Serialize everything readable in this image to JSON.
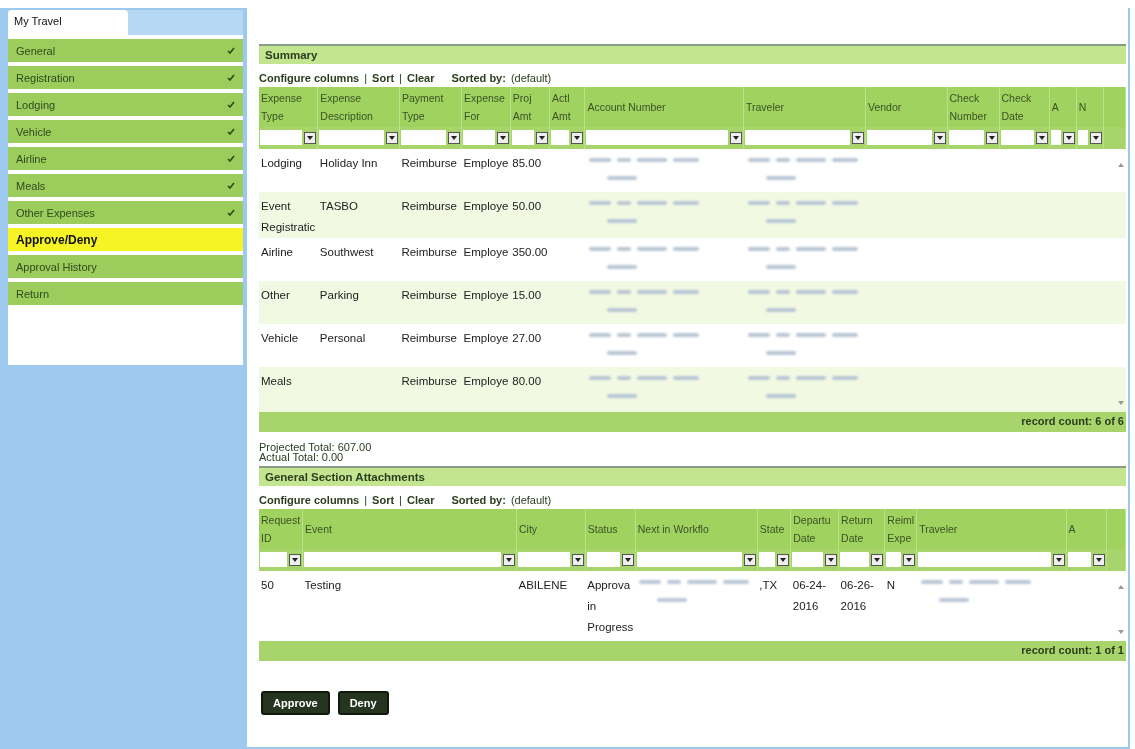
{
  "sidebar": {
    "tab": {
      "label": "My Travel",
      "selected": true
    },
    "items": [
      {
        "label": "General",
        "checked": true,
        "selected": false
      },
      {
        "label": "Registration",
        "checked": true,
        "selected": false
      },
      {
        "label": "Lodging",
        "checked": true,
        "selected": false
      },
      {
        "label": "Vehicle",
        "checked": true,
        "selected": false
      },
      {
        "label": "Airline",
        "checked": true,
        "selected": false
      },
      {
        "label": "Meals",
        "checked": true,
        "selected": false
      },
      {
        "label": "Other Expenses",
        "checked": true,
        "selected": false
      },
      {
        "label": "Approve/Deny",
        "checked": false,
        "selected": true
      },
      {
        "label": "Approval History",
        "checked": false,
        "selected": false
      },
      {
        "label": "Return",
        "checked": false,
        "selected": false
      }
    ]
  },
  "summary": {
    "title": "Summary",
    "toolbar": {
      "links": [
        "Configure columns",
        "Sort",
        "Clear"
      ],
      "separator": "|",
      "sorted_label": "Sorted by:",
      "sorted_value": "(default)"
    },
    "columns": [
      "Expense Type",
      "Expense Description",
      "Payment Type",
      "Expense For",
      "Proj Amt",
      "Actl Amt",
      "Account Number",
      "Traveler",
      "Vendor",
      "Check Number",
      "Check Date",
      "A",
      "N"
    ],
    "rows": [
      {
        "cells": [
          "Lodging",
          "Holiday Inn",
          "Reimburse",
          "Employe",
          "85.00",
          null,
          {
            "kind": "blurred"
          },
          {
            "kind": "blurred"
          },
          null,
          null,
          null,
          null,
          null
        ]
      },
      {
        "cells": [
          "Event Registratic",
          "TASBO",
          "Reimburse",
          "Employe",
          "50.00",
          null,
          {
            "kind": "blurred"
          },
          {
            "kind": "blurred"
          },
          null,
          null,
          null,
          null,
          null
        ]
      },
      {
        "cells": [
          "Airline",
          "Southwest",
          "Reimburse",
          "Employe",
          "350.00",
          null,
          {
            "kind": "blurred"
          },
          {
            "kind": "blurred"
          },
          null,
          null,
          null,
          null,
          null
        ]
      },
      {
        "cells": [
          "Other",
          "Parking",
          "Reimburse",
          "Employe",
          "15.00",
          null,
          {
            "kind": "blurred"
          },
          {
            "kind": "blurred"
          },
          null,
          null,
          null,
          null,
          null
        ]
      },
      {
        "cells": [
          "Vehicle",
          "Personal",
          "Reimburse",
          "Employe",
          "27.00",
          null,
          {
            "kind": "blurred"
          },
          {
            "kind": "blurred"
          },
          null,
          null,
          null,
          null,
          null
        ]
      },
      {
        "cells": [
          "Meals",
          null,
          "Reimburse",
          "Employe",
          "80.00",
          null,
          {
            "kind": "blurred"
          },
          {
            "kind": "blurred"
          },
          null,
          null,
          null,
          null,
          null
        ]
      }
    ],
    "record_count": "record count: 6 of 6"
  },
  "totals": [
    "Projected Total: 607.00",
    "Actual Total: 0.00"
  ],
  "attachments": {
    "title": "General Section Attachments",
    "toolbar": {
      "links": [
        "Configure columns",
        "Sort",
        "Clear"
      ],
      "separator": "|",
      "sorted_label": "Sorted by:",
      "sorted_value": "(default)"
    },
    "columns": [
      "Request ID",
      "Event",
      "City",
      "Status",
      "Next in Workflo",
      "State",
      "Departu Date",
      "Return Date",
      "Reiml Expe",
      "Traveler",
      "A"
    ],
    "rows": [
      {
        "cells": [
          "50",
          "Testing",
          "ABILENE",
          "Approva in Progress",
          {
            "kind": "blurred"
          },
          ",TX",
          "06-24-2016",
          "06-26-2016",
          "N",
          {
            "kind": "blurred"
          },
          null
        ]
      }
    ],
    "record_count": "record count: 1 of 1"
  },
  "buttons": [
    "Approve",
    "Deny"
  ]
}
